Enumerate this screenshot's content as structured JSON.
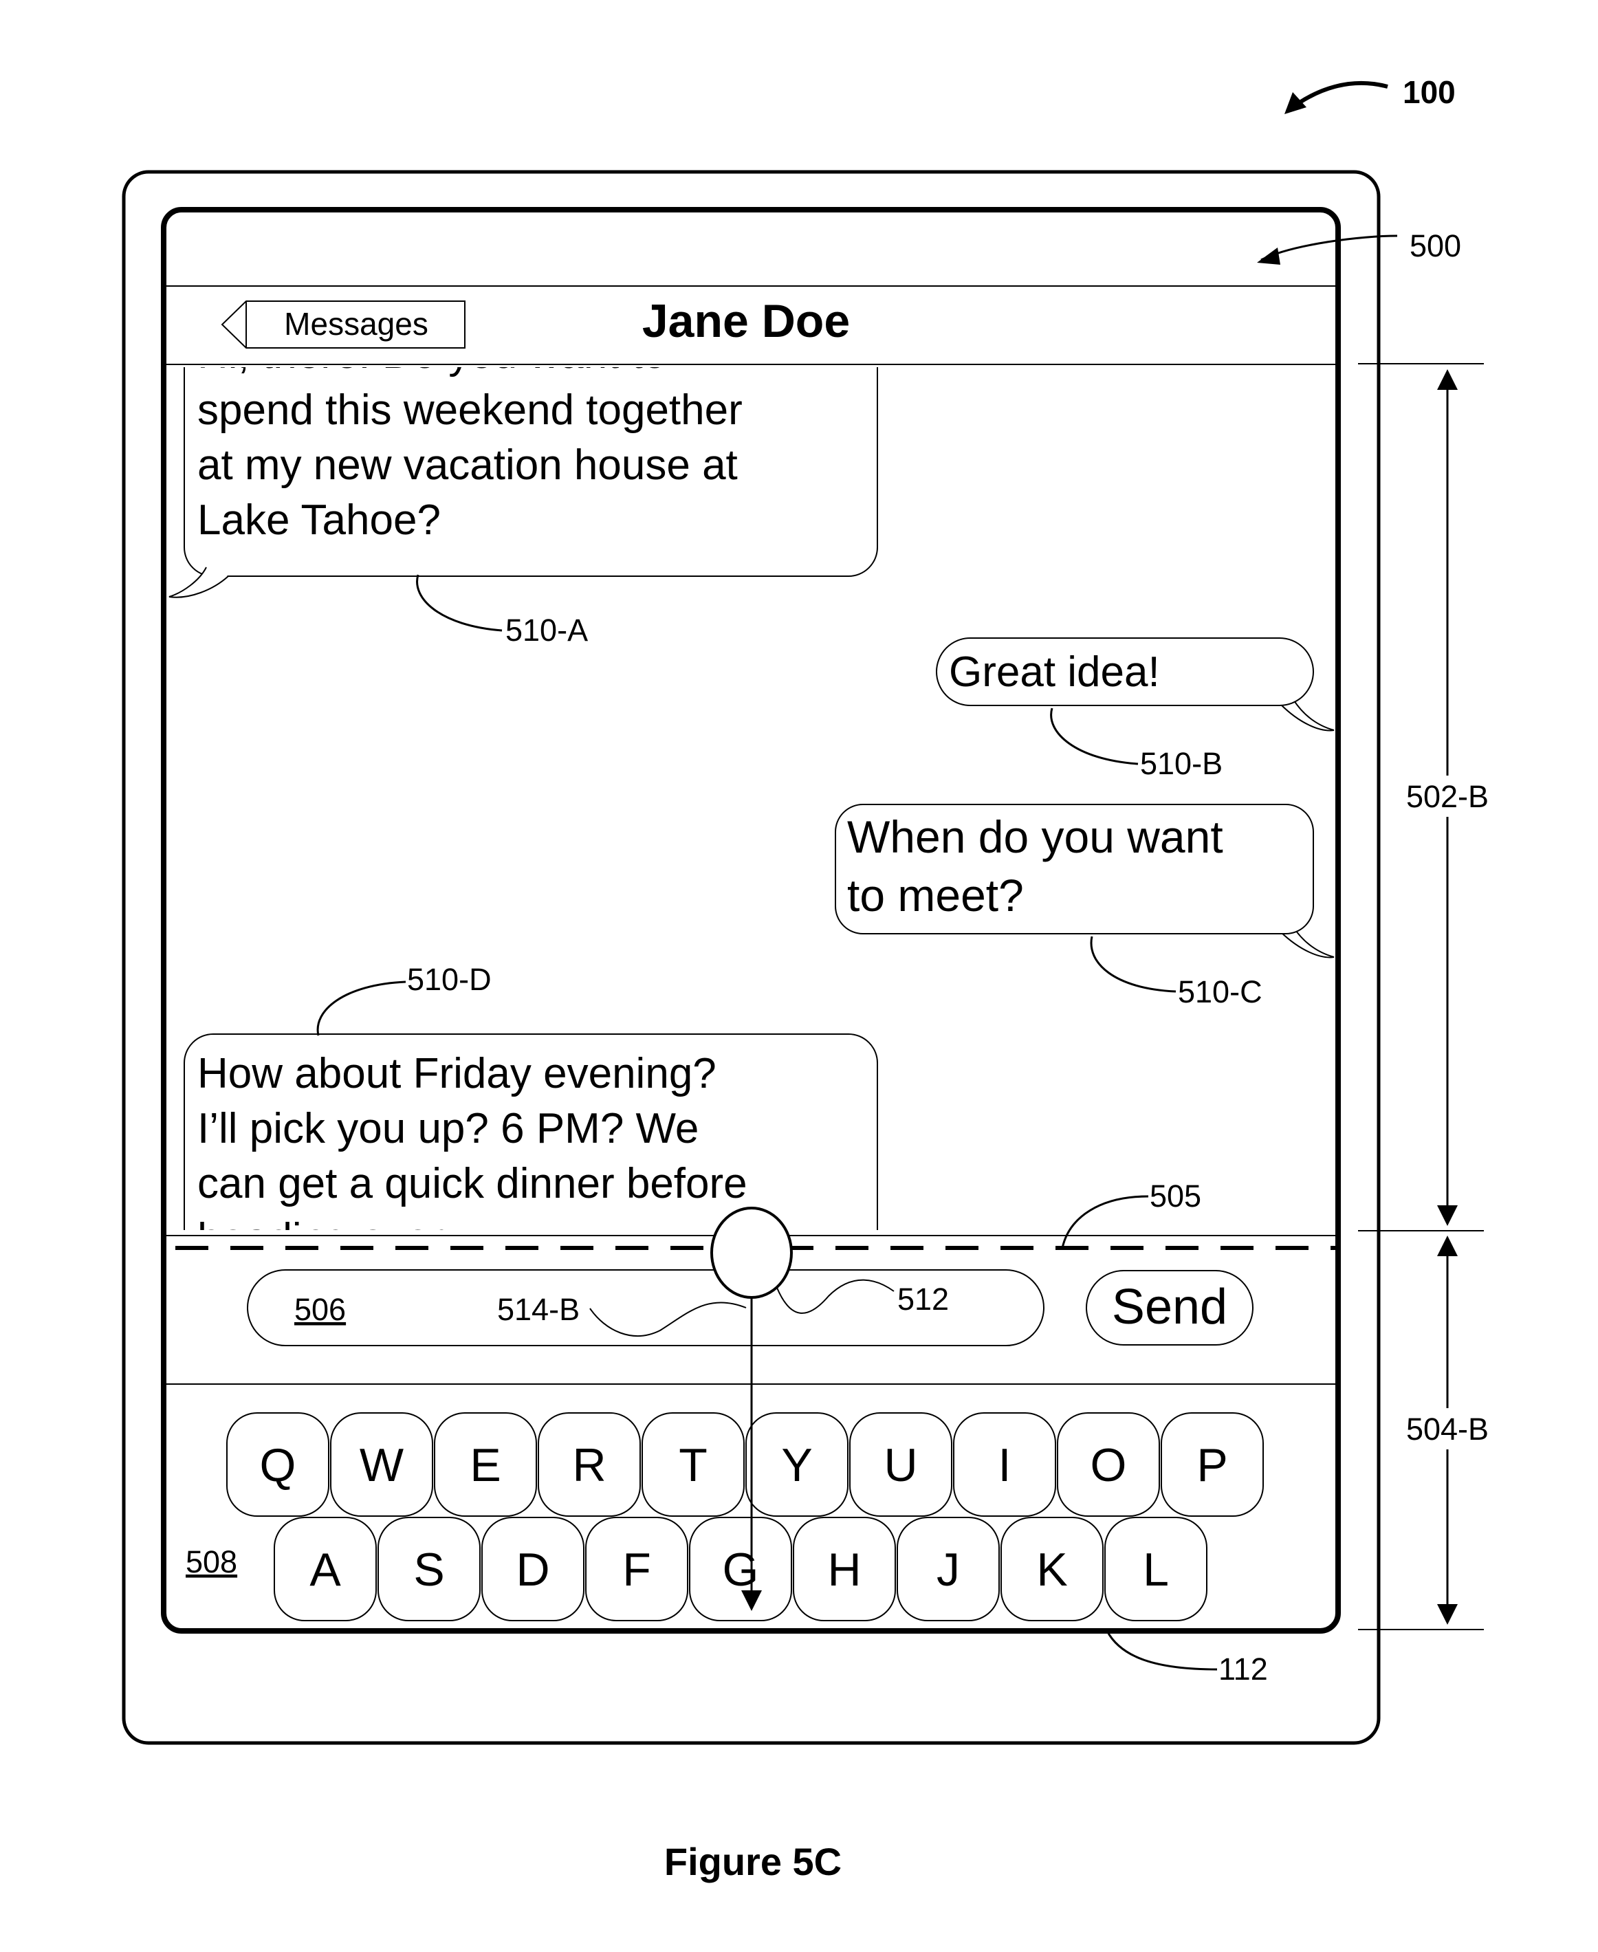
{
  "figure": {
    "caption": "Figure 5C",
    "refs": {
      "device": "100",
      "ui": "500",
      "messages_region": "502-B",
      "keyboard_region": "504-B",
      "boundary": "505",
      "input_field": "506",
      "keyboard": "508",
      "finger_contact": "512",
      "input_position": "514-B",
      "touch_screen": "112",
      "bubble_a": "510-A",
      "bubble_b": "510-B",
      "bubble_c": "510-C",
      "bubble_d": "510-D"
    }
  },
  "header": {
    "back_label": "Messages",
    "title": "Jane Doe"
  },
  "messages": [
    {
      "side": "left",
      "lines": [
        "Hi, there. Do you want to",
        "spend this weekend together",
        "at my new vacation house at",
        "Lake Tahoe?"
      ]
    },
    {
      "side": "right",
      "lines": [
        "Great idea!"
      ]
    },
    {
      "side": "right",
      "lines": [
        "When do you want",
        "to meet?"
      ]
    },
    {
      "side": "left",
      "lines": [
        "How about Friday evening?",
        "I’ll pick you up? 6 PM? We",
        "can get a quick dinner before",
        "heading over"
      ]
    }
  ],
  "composer": {
    "send_label": "Send"
  },
  "keyboard": {
    "row1": [
      "Q",
      "W",
      "E",
      "R",
      "T",
      "Y",
      "U",
      "I",
      "O",
      "P"
    ],
    "row2": [
      "A",
      "S",
      "D",
      "F",
      "G",
      "H",
      "J",
      "K",
      "L"
    ]
  }
}
